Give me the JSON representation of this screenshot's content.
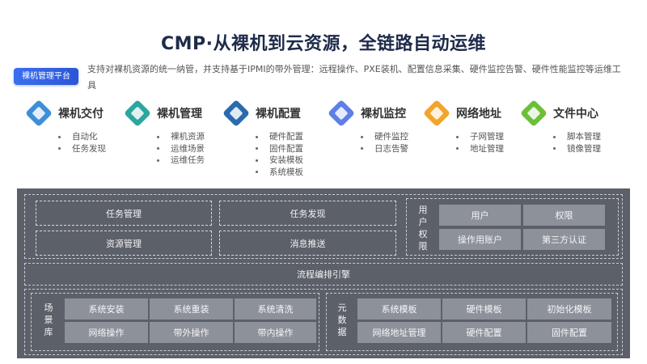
{
  "title": "CMP·从裸机到云资源，全链路自动运维",
  "badge": "裸机管理平台",
  "description": "支持对裸机资源的统一纳管，并支持基于IPMI的带外管理：远程操作、PXE装机、配置信息采集、硬件监控告警、硬件性能监控等运维工具",
  "features": [
    {
      "name": "裸机交付",
      "color": "#3e8ed9",
      "items": [
        "自动化",
        "任务发现"
      ]
    },
    {
      "name": "裸机管理",
      "color": "#2aa7a0",
      "items": [
        "裸机资源",
        "运维场景",
        "运维任务"
      ]
    },
    {
      "name": "裸机配置",
      "color": "#2a6aad",
      "items": [
        "硬件配置",
        "固件配置",
        "安装模板",
        "系统模板"
      ]
    },
    {
      "name": "裸机监控",
      "color": "#5d7fe6",
      "items": [
        "硬件监控",
        "日志告警"
      ]
    },
    {
      "name": "网络地址",
      "color": "#f2a52c",
      "items": [
        "子网管理",
        "地址管理"
      ]
    },
    {
      "name": "文件中心",
      "color": "#6cbf3a",
      "items": [
        "脚本管理",
        "镜像管理"
      ]
    }
  ],
  "architecture": {
    "task_mgmt": "任务管理",
    "task_discovery": "任务发现",
    "resource_mgmt": "资源管理",
    "message_push": "消息推送",
    "user_perm": {
      "label": "用户权限",
      "cells": [
        "用户",
        "权限",
        "操作用账户",
        "第三方认证"
      ]
    },
    "workflow_engine": "流程编排引擎",
    "scene_lib": {
      "label": "场景库",
      "cells": [
        "系统安装",
        "系统重装",
        "系统清洗",
        "网络操作",
        "带外操作",
        "带内操作"
      ]
    },
    "metadata": {
      "label": "元数据",
      "cells": [
        "系统模板",
        "硬件模板",
        "初始化模板",
        "网络地址管理",
        "硬件配置",
        "固件配置"
      ]
    }
  }
}
